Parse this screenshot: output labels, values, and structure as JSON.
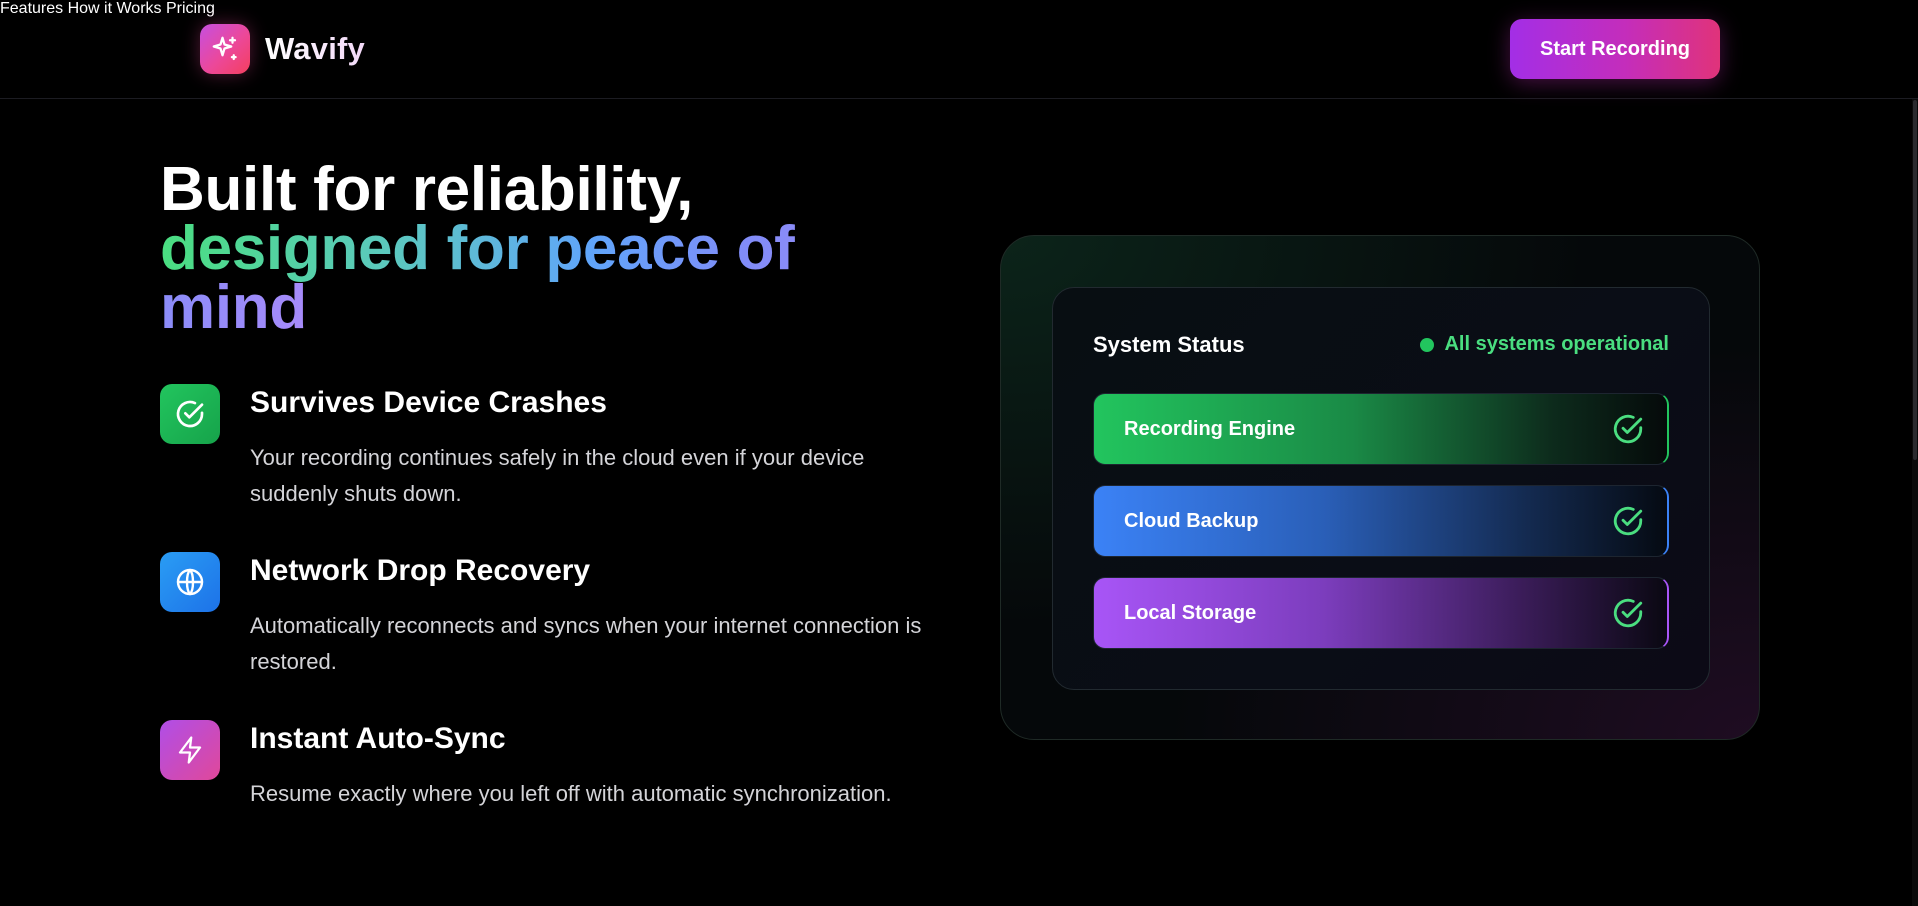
{
  "header": {
    "brand_name": "Wavify",
    "nav": [
      {
        "label": "Features"
      },
      {
        "label": "How it Works"
      },
      {
        "label": "Pricing"
      }
    ],
    "cta_label": "Start Recording"
  },
  "hero": {
    "title_line1": "Built for reliability,",
    "title_line2": "designed for peace of mind"
  },
  "features": [
    {
      "icon": "check-circle-icon",
      "title": "Survives Device Crashes",
      "description": "Your recording continues safely in the cloud even if your device suddenly shuts down."
    },
    {
      "icon": "globe-icon",
      "title": "Network Drop Recovery",
      "description": "Automatically reconnects and syncs when your internet connection is restored."
    },
    {
      "icon": "lightning-icon",
      "title": "Instant Auto-Sync",
      "description": "Resume exactly where you left off with automatic synchronization."
    }
  ],
  "status_card": {
    "title": "System Status",
    "status_text": "All systems operational",
    "status_color": "#22c55e",
    "services": [
      {
        "label": "Recording Engine",
        "color": "#22c55e",
        "icon": "check-circle-icon"
      },
      {
        "label": "Cloud Backup",
        "color": "#3b82f6",
        "icon": "check-circle-icon"
      },
      {
        "label": "Local Storage",
        "color": "#a855f7",
        "icon": "check-circle-icon"
      }
    ]
  },
  "colors": {
    "brand_gradient_start": "#a32ee6",
    "brand_gradient_end": "#e0337a",
    "feature_green": "#22c55e",
    "feature_blue": "#1d9bf0",
    "feature_purple": "#c04be6"
  }
}
